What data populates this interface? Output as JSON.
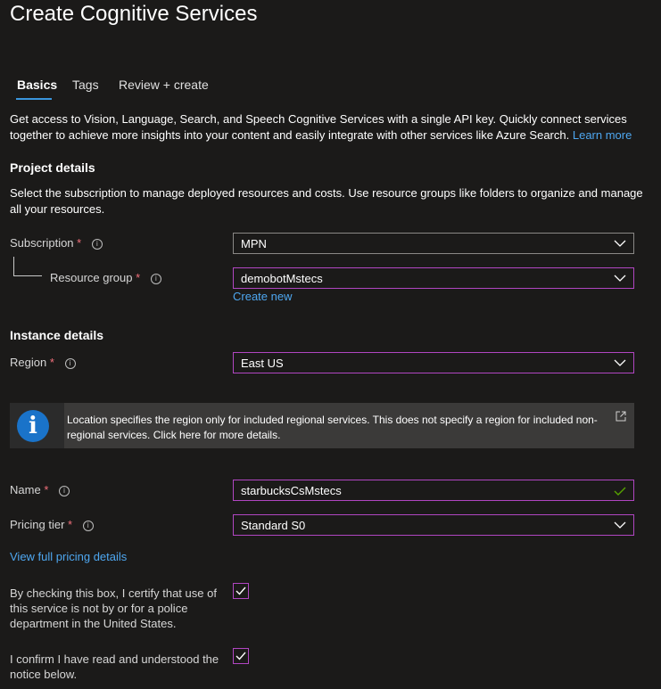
{
  "title": "Create Cognitive Services",
  "tabs": [
    {
      "label": "Basics"
    },
    {
      "label": "Tags"
    },
    {
      "label": "Review + create"
    }
  ],
  "intro": {
    "text": "Get access to Vision, Language, Search, and Speech Cognitive Services with a single API key. Quickly connect services together to achieve more insights into your content and easily integrate with other services like Azure Search.",
    "learn_more": "Learn more"
  },
  "project": {
    "heading": "Project details",
    "description": "Select the subscription to manage deployed resources and costs. Use resource groups like folders to organize and manage all your resources.",
    "subscription": {
      "label": "Subscription",
      "value": "MPN"
    },
    "resource_group": {
      "label": "Resource group",
      "value": "demobotMstecs",
      "create_new": "Create new"
    }
  },
  "instance": {
    "heading": "Instance details",
    "region": {
      "label": "Region",
      "value": "East US"
    }
  },
  "notice": {
    "text": "Location specifies the region only for included regional services. This does not specify a region for included non-regional services. Click here for more details."
  },
  "name": {
    "label": "Name",
    "value": "starbucksCsMstecs"
  },
  "pricing": {
    "label": "Pricing tier",
    "value": "Standard S0",
    "details_link": "View full pricing details"
  },
  "certify": {
    "police_text": "By checking this box, I certify that use of this service is not by or for a police department in the United States.",
    "confirm_text": "I confirm I have read and understood the notice below."
  },
  "colors": {
    "accent": "#b146c2",
    "link": "#4ea7f0",
    "required": "#f1707b",
    "valid": "#57a300"
  }
}
